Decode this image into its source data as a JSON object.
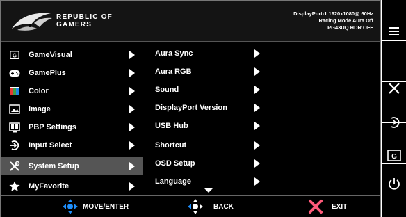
{
  "header": {
    "brand_line1": "REPUBLIC OF",
    "brand_line2": "GAMERS",
    "status_line1": "DisplayPort-1 1920x1080@ 60Hz",
    "status_line2": "Racing Mode Aura Off",
    "status_line3": "PG43UQ HDR OFF"
  },
  "main_menu": [
    {
      "label": "GameVisual",
      "icon": "gamevisual-icon"
    },
    {
      "label": "GamePlus",
      "icon": "gamepad-icon"
    },
    {
      "label": "Color",
      "icon": "color-palette-icon"
    },
    {
      "label": "Image",
      "icon": "image-icon"
    },
    {
      "label": "PBP Settings",
      "icon": "pbp-icon"
    },
    {
      "label": "Input Select",
      "icon": "input-icon"
    },
    {
      "label": "System Setup",
      "icon": "tools-icon",
      "selected": true
    },
    {
      "label": "MyFavorite",
      "icon": "star-icon"
    }
  ],
  "sub_menu": [
    {
      "label": "Aura Sync"
    },
    {
      "label": "Aura RGB"
    },
    {
      "label": "Sound"
    },
    {
      "label": "DisplayPort Version"
    },
    {
      "label": "USB Hub"
    },
    {
      "label": "Shortcut"
    },
    {
      "label": "OSD Setup"
    },
    {
      "label": "Language"
    }
  ],
  "footer": {
    "move_enter": "MOVE/ENTER",
    "back": "BACK",
    "exit": "EXIT"
  },
  "side_buttons": [
    "menu-icon",
    "close-icon",
    "input-icon",
    "gamevisual-icon",
    "power-icon"
  ],
  "colors": {
    "accent_blue": "#1e90ff",
    "exit_pink": "#ff5a7a",
    "selected_bg": "#555555"
  }
}
